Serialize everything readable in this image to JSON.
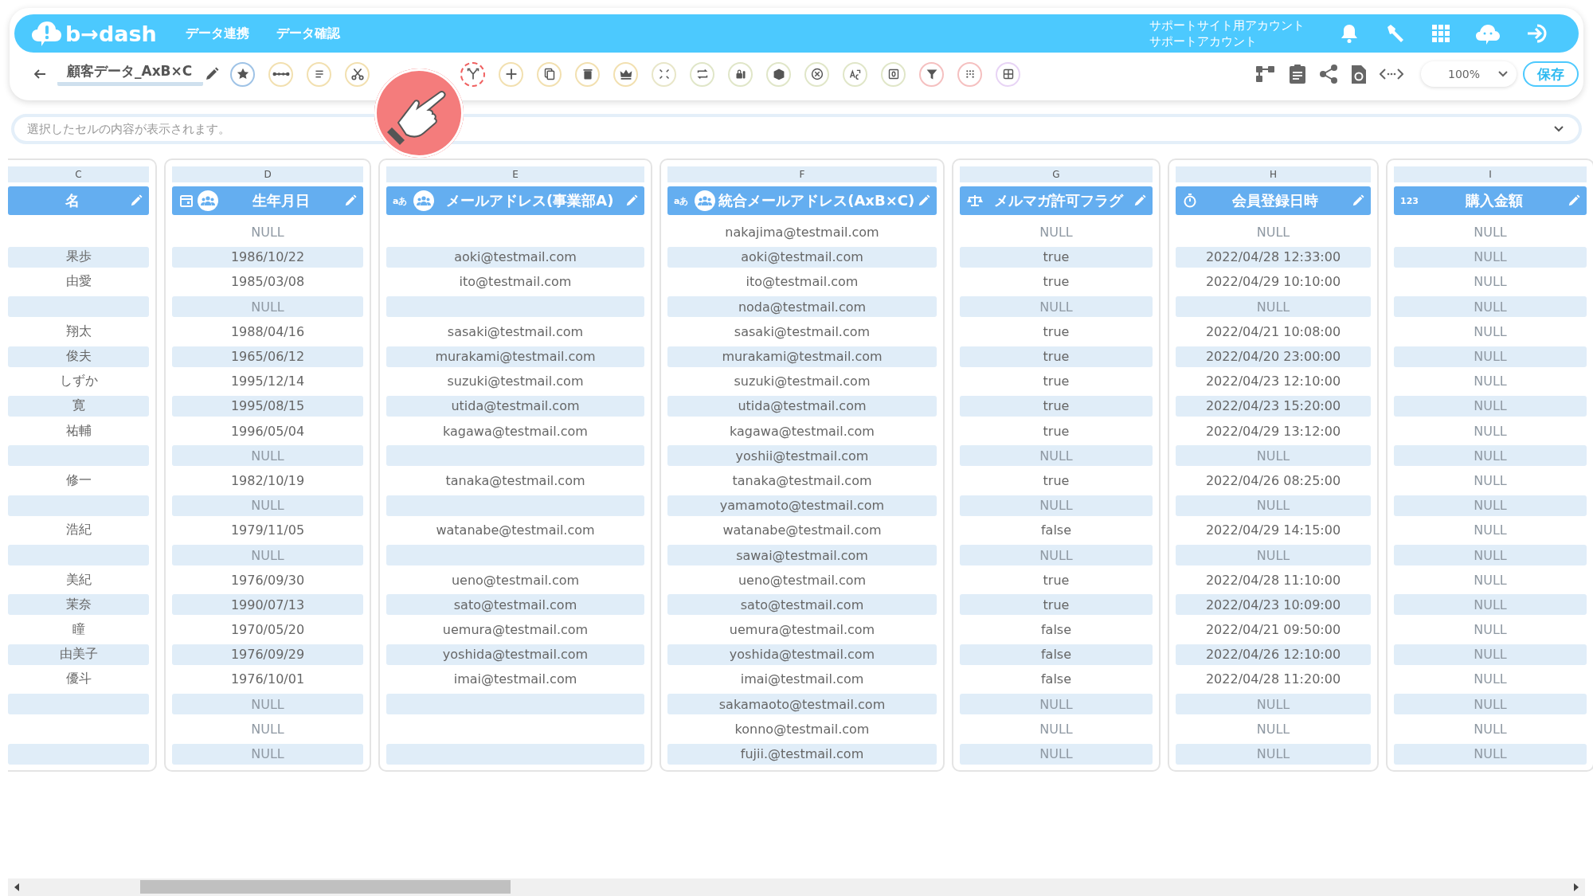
{
  "header": {
    "logo_text": "b→dash",
    "nav": [
      {
        "label": "データ連携"
      },
      {
        "label": "データ確認"
      }
    ],
    "account": [
      "サポートサイト用アカウント",
      "サポートアカウント"
    ]
  },
  "toolbar": {
    "title": "顧客データ_AxB×C",
    "tools": [
      {
        "highlighted": false
      },
      {
        "highlighted": false
      },
      {
        "highlighted": false
      },
      {
        "highlighted": false
      },
      {
        "highlighted": true
      },
      {
        "highlighted": false
      },
      {
        "highlighted": false
      },
      {
        "highlighted": false
      },
      {
        "highlighted": false
      },
      {
        "highlighted": false
      },
      {
        "highlighted": false
      },
      {
        "highlighted": false
      },
      {
        "highlighted": false
      },
      {
        "highlighted": false
      },
      {
        "highlighted": false
      },
      {
        "highlighted": false
      },
      {
        "highlighted": false
      },
      {
        "highlighted": false
      },
      {
        "highlighted": false
      }
    ],
    "zoom": "100%",
    "save": "保存"
  },
  "cell_view": {
    "placeholder": "選択したセルの内容が表示されます。"
  },
  "columns": [
    {
      "letter": "C",
      "title": "名",
      "kind": "plain",
      "shared": false
    },
    {
      "letter": "D",
      "title": "生年月日",
      "kind": "date",
      "shared": true
    },
    {
      "letter": "E",
      "title": "メールアドレス(事業部A)",
      "kind": "text",
      "badge": "aあ",
      "shared": true
    },
    {
      "letter": "F",
      "title": "統合メールアドレス(AxB×C)",
      "kind": "text",
      "badge": "aあ",
      "shared": true
    },
    {
      "letter": "G",
      "title": "メルマガ許可フラグ",
      "kind": "bool",
      "shared": false
    },
    {
      "letter": "H",
      "title": "会員登録日時",
      "kind": "datetime",
      "shared": false
    },
    {
      "letter": "I",
      "title": "購入金額",
      "kind": "number",
      "badge": "123",
      "shared": false
    }
  ],
  "rows": [
    {
      "cells": [
        null,
        {
          "kind": "null",
          "text": "NULL"
        },
        null,
        "nakajima@testmail.com",
        {
          "kind": "null",
          "text": "NULL"
        },
        {
          "kind": "null",
          "text": "NULL"
        },
        {
          "kind": "null",
          "text": "NULL"
        }
      ]
    },
    {
      "cells": [
        "果歩",
        "1986/10/22",
        "aoki@testmail.com",
        "aoki@testmail.com",
        "true",
        "2022/04/28 12:33:00",
        {
          "kind": "null",
          "text": "NULL"
        }
      ]
    },
    {
      "cells": [
        "由愛",
        "1985/03/08",
        "ito@testmail.com",
        "ito@testmail.com",
        "true",
        "2022/04/29 10:10:00",
        {
          "kind": "null",
          "text": "NULL"
        }
      ]
    },
    {
      "cells": [
        null,
        {
          "kind": "null",
          "text": "NULL"
        },
        null,
        "noda@testmail.com",
        {
          "kind": "null",
          "text": "NULL"
        },
        {
          "kind": "null",
          "text": "NULL"
        },
        {
          "kind": "null",
          "text": "NULL"
        }
      ]
    },
    {
      "cells": [
        "翔太",
        "1988/04/16",
        "sasaki@testmail.com",
        "sasaki@testmail.com",
        "true",
        "2022/04/21 10:08:00",
        {
          "kind": "null",
          "text": "NULL"
        }
      ]
    },
    {
      "cells": [
        "俊夫",
        "1965/06/12",
        "murakami@testmail.com",
        "murakami@testmail.com",
        "true",
        "2022/04/20 23:00:00",
        {
          "kind": "null",
          "text": "NULL"
        }
      ]
    },
    {
      "cells": [
        "しずか",
        "1995/12/14",
        "suzuki@testmail.com",
        "suzuki@testmail.com",
        "true",
        "2022/04/23 12:10:00",
        {
          "kind": "null",
          "text": "NULL"
        }
      ]
    },
    {
      "cells": [
        "寛",
        "1995/08/15",
        "utida@testmail.com",
        "utida@testmail.com",
        "true",
        "2022/04/23 15:20:00",
        {
          "kind": "null",
          "text": "NULL"
        }
      ]
    },
    {
      "cells": [
        "祐輔",
        "1996/05/04",
        "kagawa@testmail.com",
        "kagawa@testmail.com",
        "true",
        "2022/04/29 13:12:00",
        {
          "kind": "null",
          "text": "NULL"
        }
      ]
    },
    {
      "cells": [
        null,
        {
          "kind": "null",
          "text": "NULL"
        },
        null,
        "yoshii@testmail.com",
        {
          "kind": "null",
          "text": "NULL"
        },
        {
          "kind": "null",
          "text": "NULL"
        },
        {
          "kind": "null",
          "text": "NULL"
        }
      ]
    },
    {
      "cells": [
        "修一",
        "1982/10/19",
        "tanaka@testmail.com",
        "tanaka@testmail.com",
        "true",
        "2022/04/26 08:25:00",
        {
          "kind": "null",
          "text": "NULL"
        }
      ]
    },
    {
      "cells": [
        null,
        {
          "kind": "null",
          "text": "NULL"
        },
        null,
        "yamamoto@testmail.com",
        {
          "kind": "null",
          "text": "NULL"
        },
        {
          "kind": "null",
          "text": "NULL"
        },
        {
          "kind": "null",
          "text": "NULL"
        }
      ]
    },
    {
      "cells": [
        "浩紀",
        "1979/11/05",
        "watanabe@testmail.com",
        "watanabe@testmail.com",
        "false",
        "2022/04/29 14:15:00",
        {
          "kind": "null",
          "text": "NULL"
        }
      ]
    },
    {
      "cells": [
        null,
        {
          "kind": "null",
          "text": "NULL"
        },
        null,
        "sawai@testmail.com",
        {
          "kind": "null",
          "text": "NULL"
        },
        {
          "kind": "null",
          "text": "NULL"
        },
        {
          "kind": "null",
          "text": "NULL"
        }
      ]
    },
    {
      "cells": [
        "美紀",
        "1976/09/30",
        "ueno@testmail.com",
        "ueno@testmail.com",
        "true",
        "2022/04/28 11:10:00",
        {
          "kind": "null",
          "text": "NULL"
        }
      ]
    },
    {
      "cells": [
        "茉奈",
        "1990/07/13",
        "sato@testmail.com",
        "sato@testmail.com",
        "true",
        "2022/04/23 10:09:00",
        {
          "kind": "null",
          "text": "NULL"
        }
      ]
    },
    {
      "cells": [
        "瞳",
        "1970/05/20",
        "uemura@testmail.com",
        "uemura@testmail.com",
        "false",
        "2022/04/21 09:50:00",
        {
          "kind": "null",
          "text": "NULL"
        }
      ]
    },
    {
      "cells": [
        "由美子",
        "1976/09/29",
        "yoshida@testmail.com",
        "yoshida@testmail.com",
        "false",
        "2022/04/26 12:10:00",
        {
          "kind": "null",
          "text": "NULL"
        }
      ]
    },
    {
      "cells": [
        "優斗",
        "1976/10/01",
        "imai@testmail.com",
        "imai@testmail.com",
        "false",
        "2022/04/28 11:20:00",
        {
          "kind": "null",
          "text": "NULL"
        }
      ]
    },
    {
      "cells": [
        null,
        {
          "kind": "null",
          "text": "NULL"
        },
        null,
        "sakamaoto@testmail.com",
        {
          "kind": "null",
          "text": "NULL"
        },
        {
          "kind": "null",
          "text": "NULL"
        },
        {
          "kind": "null",
          "text": "NULL"
        }
      ]
    },
    {
      "cells": [
        null,
        {
          "kind": "null",
          "text": "NULL"
        },
        null,
        "konno@testmail.com",
        {
          "kind": "null",
          "text": "NULL"
        },
        {
          "kind": "null",
          "text": "NULL"
        },
        {
          "kind": "null",
          "text": "NULL"
        }
      ]
    },
    {
      "cells": [
        null,
        {
          "kind": "null",
          "text": "NULL"
        },
        null,
        "fujii.@testmail.com",
        {
          "kind": "null",
          "text": "NULL"
        },
        {
          "kind": "null",
          "text": "NULL"
        },
        {
          "kind": "null",
          "text": "NULL"
        }
      ]
    }
  ]
}
